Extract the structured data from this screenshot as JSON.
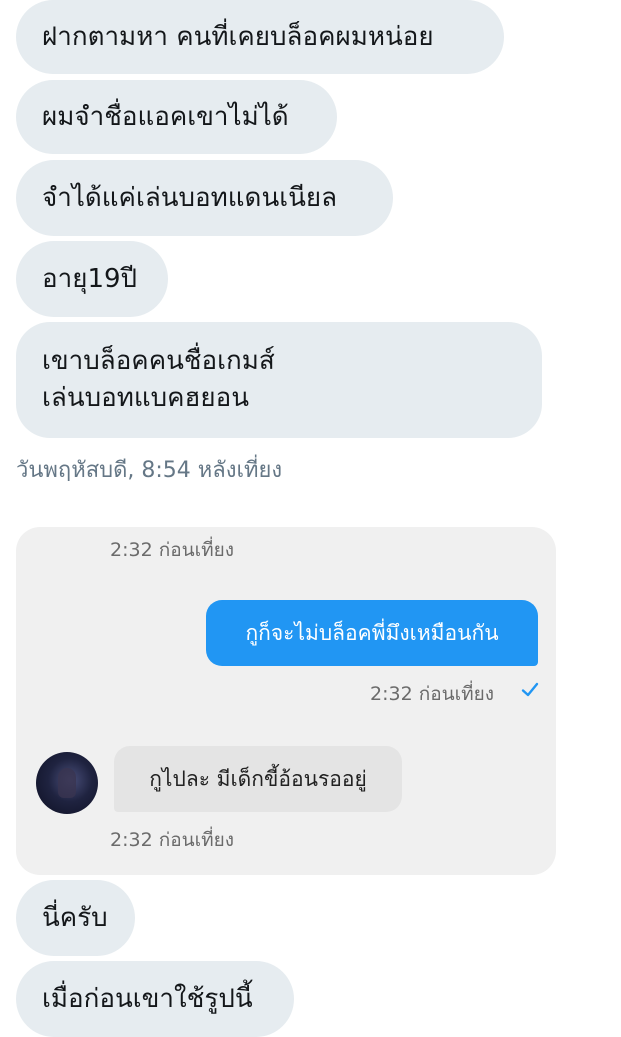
{
  "messages": [
    {
      "lines": [
        "ฝากตามหา คนที่เคยบล็อคผมหน่อย"
      ]
    },
    {
      "lines": [
        "ผมจำชื่อแอคเขาไม่ได้"
      ]
    },
    {
      "lines": [
        "จำได้แค่เล่นบอทแดนเนียล"
      ]
    },
    {
      "lines": [
        "อายุ19ปี"
      ]
    },
    {
      "lines": [
        "เขาบล็อคคนชื่อเกมส์",
        "เล่นบอทแบคฮยอน"
      ]
    }
  ],
  "group_timestamp": "วันพฤหัสบดี, 8:54 หลังเที่ยง",
  "screenshot": {
    "time_top": "2:32 ก่อนเที่ยง",
    "outgoing_text": "กูก็จะไม่บล็อคพี่มึงเหมือนกัน",
    "outgoing_time": "2:32 ก่อนเที่ยง",
    "read_icon": "check-icon",
    "incoming_text": "กูไปละ มีเด็กขี้อ้อนรออยู่",
    "incoming_time": "2:32 ก่อนเที่ยง",
    "outgoing_color": "#2196f3"
  },
  "messages_after": [
    {
      "lines": [
        "นี่ครับ"
      ]
    },
    {
      "lines": [
        "เมื่อก่อนเขาใช้รูปนี้"
      ]
    }
  ],
  "colors": {
    "bubble_bg": "#e6ecf0",
    "text": "#14171a",
    "timestamp": "#657786"
  }
}
